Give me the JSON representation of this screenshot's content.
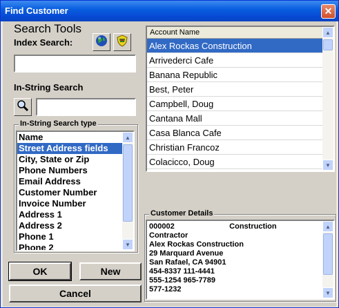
{
  "window": {
    "title": "Find Customer",
    "close_glyph": "✕"
  },
  "search": {
    "tools_label": "Search Tools",
    "index_label": "Index Search:",
    "index_value": "",
    "instring_label": "In-String Search",
    "instring_value": "",
    "type_group_label": "In-String Search type",
    "types": [
      "Name",
      "Street Address fields",
      "City, State or Zip",
      "Phone Numbers",
      "Email Address",
      "Customer Number",
      "Invoice Number",
      "Address 1",
      "Address 2",
      "Phone 1",
      "Phone 2"
    ],
    "selected_type": "Street Address fields"
  },
  "accounts": {
    "header": "Account Name",
    "items": [
      "Alex Rockas Construction",
      "Arrivederci Cafe",
      "Banana Republic",
      "Best, Peter",
      "Campbell, Doug",
      "Cantana Mall",
      "Casa Blanca Cafe",
      "Christian Francoz",
      "Colacicco, Doug"
    ],
    "selected": "Alex Rockas Construction"
  },
  "details": {
    "label": "Customer Details",
    "lines": [
      "000002                          Construction",
      "Contractor",
      "Alex Rockas Construction",
      "29 Marquard Avenue",
      "San Rafael, CA 94901",
      "454-8337 111-4441",
      "555-1254 965-7789",
      "577-1232"
    ]
  },
  "buttons": {
    "ok": "OK",
    "new": "New",
    "cancel": "Cancel"
  },
  "icons": {
    "globe": "globe-icon",
    "shield": "shield-icon",
    "magnifier": "magnifier-icon",
    "close": "close-icon",
    "scroll_up": "▲",
    "scroll_down": "▼"
  },
  "colors": {
    "title_bar": "#0a5fe0",
    "selection": "#316ac5",
    "face": "#d4d0c8"
  }
}
